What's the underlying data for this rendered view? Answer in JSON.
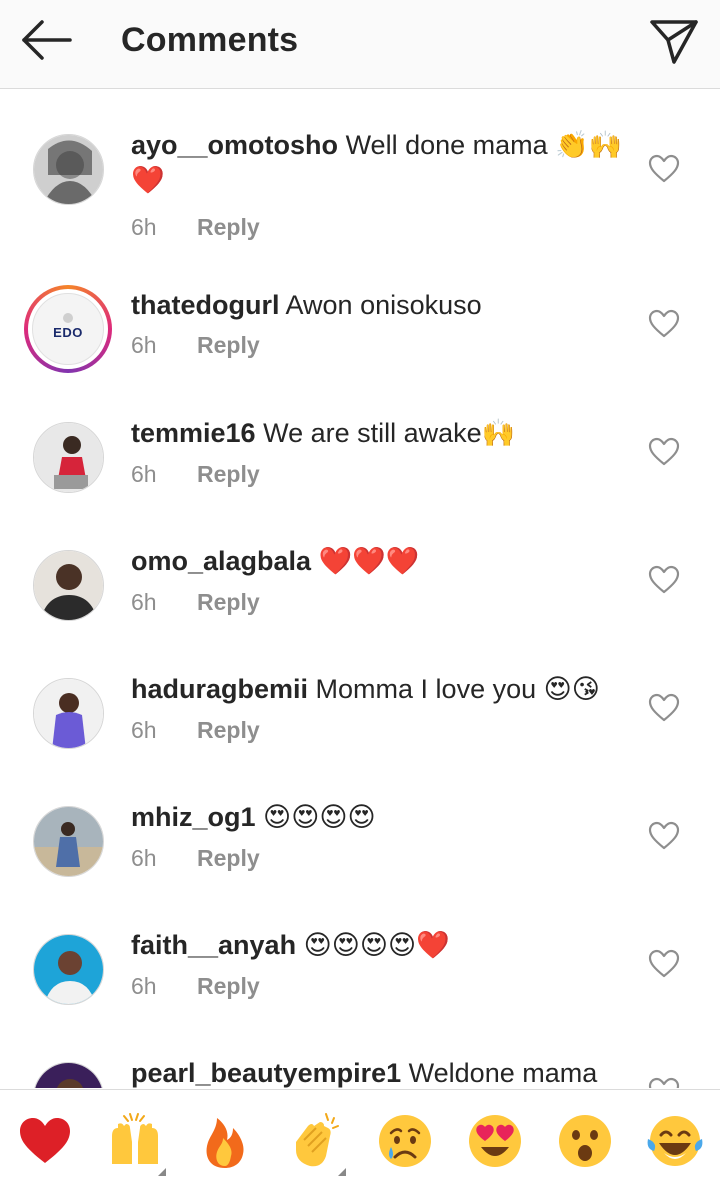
{
  "header": {
    "title": "Comments",
    "back_icon": "arrow-left-icon",
    "send_icon": "paper-plane-icon"
  },
  "comments": [
    {
      "username": "ayo__omotosho",
      "text": "Well done mama",
      "emojis": "👏🙌❤️",
      "time": "6h",
      "reply": "Reply"
    },
    {
      "username": "thatedogurl",
      "text": "Awon onisokuso",
      "emojis": "",
      "time": "6h",
      "reply": "Reply",
      "avatar_logo": "EDO"
    },
    {
      "username": "temmie16",
      "text": "We are still awake",
      "emojis": "🙌",
      "time": "6h",
      "reply": "Reply"
    },
    {
      "username": "omo_alagbala",
      "text": "",
      "emojis": "❤️❤️❤️",
      "time": "6h",
      "reply": "Reply"
    },
    {
      "username": "haduragbemii",
      "text": "Momma I love you",
      "emojis": "😍😘",
      "time": "6h",
      "reply": "Reply"
    },
    {
      "username": "mhiz_og1",
      "text": "",
      "emojis": "😍😍😍😍",
      "time": "6h",
      "reply": "Reply"
    },
    {
      "username": "faith__anyah",
      "text": "",
      "emojis": "😍😍😍😍❤️",
      "time": "6h",
      "reply": "Reply"
    },
    {
      "username": "pearl_beautyempire1",
      "text": "Weldone mama",
      "emojis": "",
      "time": "",
      "reply": ""
    }
  ],
  "reactions": [
    "heart-emoji",
    "raised-hands-emoji",
    "fire-emoji",
    "clapping-hands-emoji",
    "crying-face-emoji",
    "heart-eyes-emoji",
    "surprised-face-emoji",
    "tears-of-joy-emoji"
  ],
  "colors": {
    "text": "#262626",
    "secondary": "#8e8e8e",
    "divider": "#dbdbdb",
    "header_bg": "#fafafa",
    "heart_red": "#e0262e",
    "emoji_yellow": "#ffcc33"
  }
}
